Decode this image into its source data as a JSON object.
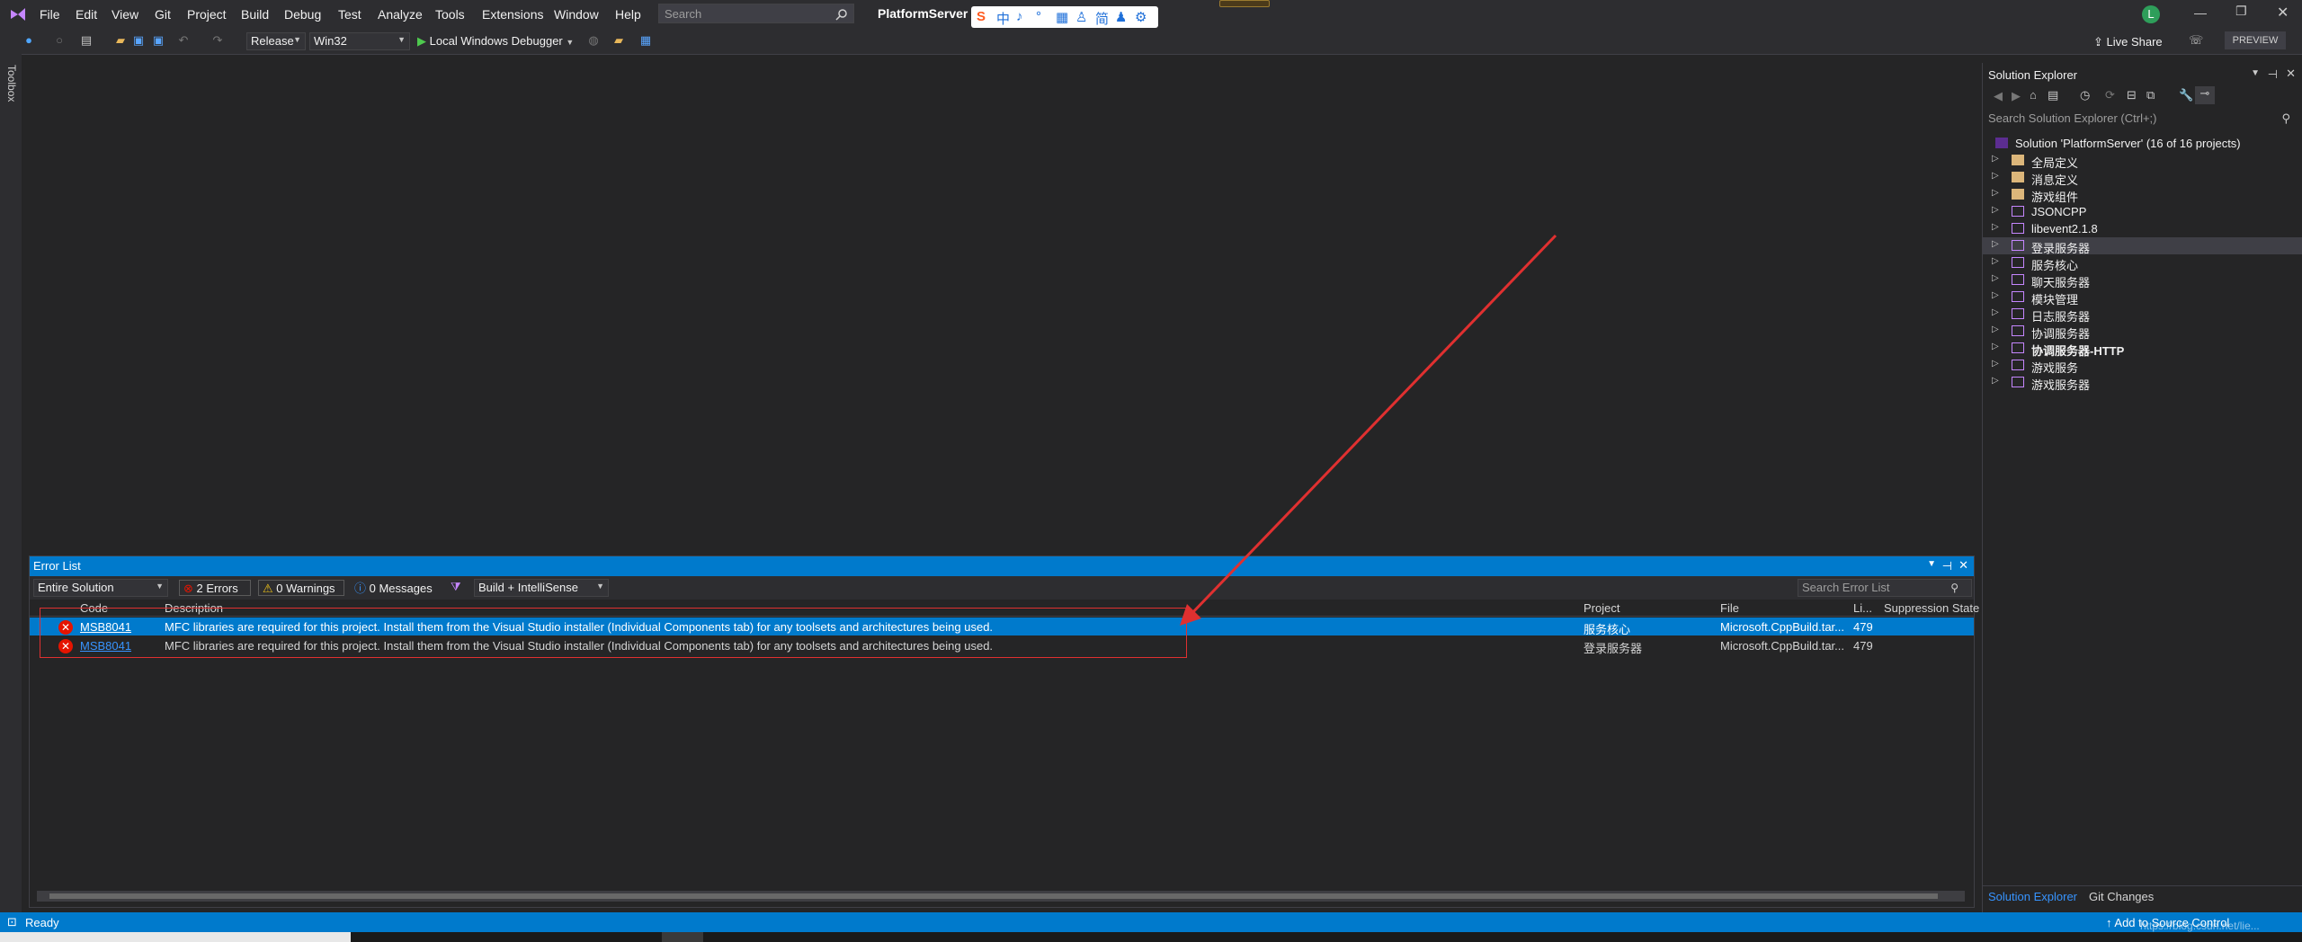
{
  "app": {
    "solution_name": "PlatformServer",
    "live_share": "Live Share",
    "preview": "PREVIEW",
    "account_initial": "L"
  },
  "menu": [
    "File",
    "Edit",
    "View",
    "Git",
    "Project",
    "Build",
    "Debug",
    "Test",
    "Analyze",
    "Tools",
    "Extensions",
    "Window",
    "Help"
  ],
  "search": {
    "placeholder": "Search"
  },
  "ime": {
    "items": [
      "S",
      "中",
      "♪",
      "°",
      "▦",
      "♙",
      "简",
      "♟",
      "⚙"
    ]
  },
  "toolbar": {
    "config": "Release",
    "platform": "Win32",
    "run_label": "Local Windows Debugger"
  },
  "toolbox": {
    "label": "Toolbox"
  },
  "error_list": {
    "title": "Error List",
    "scope": "Entire Solution",
    "errors": "2 Errors",
    "warnings": "0 Warnings",
    "messages": "0 Messages",
    "source": "Build + IntelliSense",
    "search_placeholder": "Search Error List",
    "columns": {
      "code": "Code",
      "description": "Description",
      "project": "Project",
      "file": "File",
      "line": "Li...",
      "suppression": "Suppression State"
    },
    "rows": [
      {
        "code": "MSB8041",
        "description": "MFC libraries are required for this project. Install them from the Visual Studio installer (Individual Components tab) for any toolsets and architectures being used.",
        "project": "服务核心",
        "file": "Microsoft.CppBuild.tar...",
        "line": "479"
      },
      {
        "code": "MSB8041",
        "description": "MFC libraries are required for this project. Install them from the Visual Studio installer (Individual Components tab) for any toolsets and architectures being used.",
        "project": "登录服务器",
        "file": "Microsoft.CppBuild.tar...",
        "line": "479"
      }
    ]
  },
  "solution_explorer": {
    "title": "Solution Explorer",
    "search_placeholder": "Search Solution Explorer (Ctrl+;)",
    "root": "Solution 'PlatformServer' (16 of 16 projects)",
    "items": [
      {
        "label": "全局定义",
        "kind": "folder"
      },
      {
        "label": "消息定义",
        "kind": "folder"
      },
      {
        "label": "游戏组件",
        "kind": "folder"
      },
      {
        "label": "JSONCPP",
        "kind": "project"
      },
      {
        "label": "libevent2.1.8",
        "kind": "project"
      },
      {
        "label": "登录服务器",
        "kind": "project"
      },
      {
        "label": "服务核心",
        "kind": "project"
      },
      {
        "label": "聊天服务器",
        "kind": "project"
      },
      {
        "label": "模块管理",
        "kind": "project"
      },
      {
        "label": "日志服务器",
        "kind": "project"
      },
      {
        "label": "协调服务器",
        "kind": "project"
      },
      {
        "label": "协调服务器-HTTP",
        "kind": "project"
      },
      {
        "label": "游戏服务",
        "kind": "project"
      },
      {
        "label": "游戏服务器",
        "kind": "project"
      }
    ],
    "tabs": [
      "Solution Explorer",
      "Git Changes"
    ]
  },
  "status": {
    "ready": "Ready",
    "add_source_control": "Add to Source Control",
    "watermark": "https://blog.csdn.net/lie..."
  },
  "colors": {
    "accent": "#007acc",
    "error": "#e51400",
    "annotation": "#e03030"
  }
}
